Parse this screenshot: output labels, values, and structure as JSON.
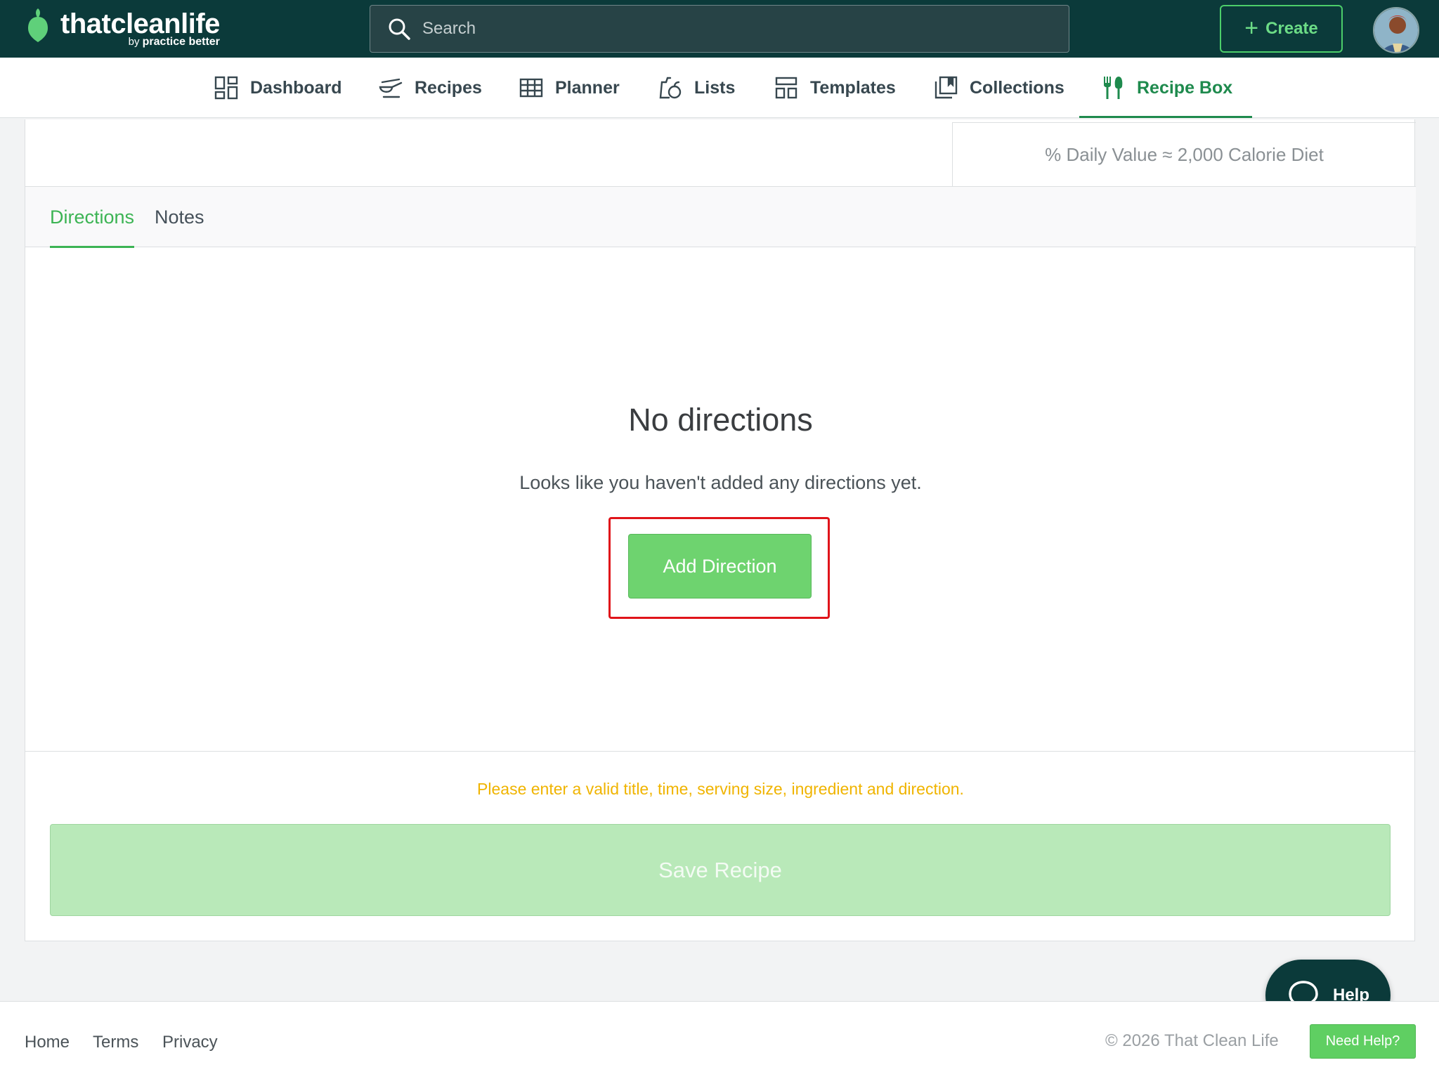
{
  "brand": {
    "name": "thatcleanlife",
    "by": "by",
    "by_brand": "practice better"
  },
  "search": {
    "placeholder": "Search"
  },
  "header": {
    "create_label": "Create"
  },
  "nav": {
    "items": [
      {
        "label": "Dashboard",
        "icon": "dashboard-icon"
      },
      {
        "label": "Recipes",
        "icon": "recipes-icon"
      },
      {
        "label": "Planner",
        "icon": "planner-icon"
      },
      {
        "label": "Lists",
        "icon": "lists-icon"
      },
      {
        "label": "Templates",
        "icon": "templates-icon"
      },
      {
        "label": "Collections",
        "icon": "collections-icon"
      },
      {
        "label": "Recipe Box",
        "icon": "fork-knife-icon",
        "active": true
      }
    ]
  },
  "nutrition": {
    "daily_value_note": "% Daily Value ≈ 2,000 Calorie Diet"
  },
  "tabs": [
    {
      "label": "Directions",
      "active": true
    },
    {
      "label": "Notes",
      "active": false
    }
  ],
  "empty_state": {
    "title": "No directions",
    "message": "Looks like you haven't added any directions yet.",
    "button_label": "Add Direction"
  },
  "form": {
    "warning": "Please enter a valid title, time, serving size, ingredient and direction.",
    "save_label": "Save Recipe"
  },
  "footer": {
    "links": [
      "Home",
      "Terms",
      "Privacy"
    ],
    "copyright": "© 2026 That Clean Life",
    "need_help_label": "Need Help?"
  },
  "help_widget": {
    "label": "Help"
  },
  "colors": {
    "header_bg": "#0b3a3a",
    "accent_green": "#3cb454",
    "nav_active": "#1e8a4d",
    "warning": "#f0b400",
    "highlight": "#e0141a"
  }
}
